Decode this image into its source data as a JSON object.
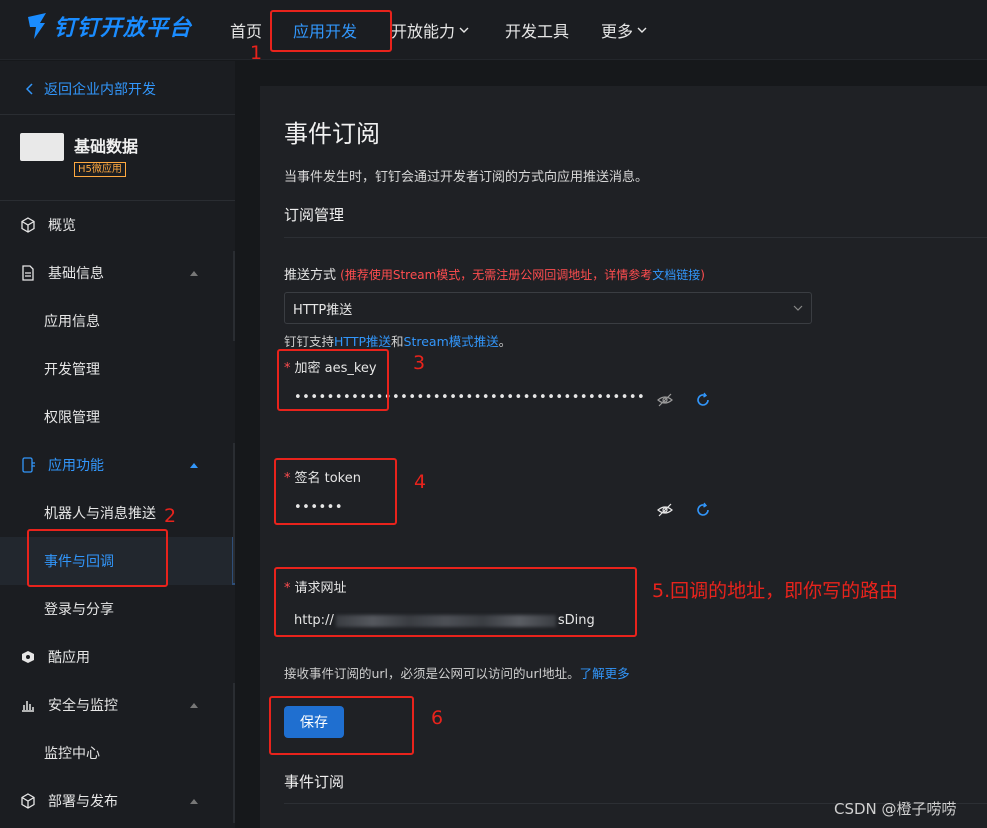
{
  "topnav": {
    "logo_text": "钉钉开放平台",
    "items": [
      {
        "label": "首页"
      },
      {
        "label": "应用开发",
        "active": true
      },
      {
        "label": "开放能力",
        "dropdown": true
      },
      {
        "label": "开发工具"
      },
      {
        "label": "更多",
        "dropdown": true
      }
    ]
  },
  "sidebar": {
    "back_label": "返回企业内部开发",
    "app": {
      "name": "基础数据",
      "badge": "H5微应用"
    },
    "items": [
      {
        "label": "概览",
        "icon": "cube-icon"
      },
      {
        "label": "基础信息",
        "icon": "document-icon",
        "expanded": true
      },
      {
        "label": "应用信息"
      },
      {
        "label": "开发管理"
      },
      {
        "label": "权限管理"
      },
      {
        "label": "应用功能",
        "icon": "phone-icon",
        "expanded": true
      },
      {
        "label": "机器人与消息推送"
      },
      {
        "label": "事件与回调",
        "selected": true
      },
      {
        "label": "登录与分享"
      },
      {
        "label": "酷应用",
        "icon": "cool-app-icon"
      },
      {
        "label": "安全与监控",
        "icon": "bar-chart-icon",
        "expanded": true
      },
      {
        "label": "监控中心"
      },
      {
        "label": "部署与发布",
        "icon": "cube-icon",
        "expanded": true
      }
    ]
  },
  "main": {
    "title": "事件订阅",
    "description": "当事件发生时，钉钉会通过开发者订阅的方式向应用推送消息。",
    "subscription_title": "订阅管理",
    "push_mode": {
      "label": "推送方式",
      "note": "(推荐使用Stream模式，无需注册公网回调地址，详情参考",
      "note_link": "文档链接",
      "note_end": ")",
      "selected": "HTTP推送",
      "help_prefix": "钉钉支持",
      "help_link1": "HTTP推送",
      "help_mid": "和",
      "help_link2": "Stream模式推送",
      "help_end": "。"
    },
    "aes_key": {
      "label": "加密 aes_key",
      "value": "•••••••••••••••••••••••••••••••••••••••••••"
    },
    "token": {
      "label": "签名 token",
      "value": "••••••"
    },
    "request_url": {
      "label": "请求网址",
      "prefix": "http://",
      "suffix": "sDing"
    },
    "url_help": "接收事件订阅的url，必须是公网可以访问的url地址。",
    "url_help_link": "了解更多",
    "save_label": "保存",
    "event_subscription_title": "事件订阅"
  },
  "annotations": [
    "1",
    "2",
    "3",
    "4",
    "5.回调的地址，即你写的路由",
    "6"
  ],
  "watermark": "CSDN @橙子唠唠",
  "colors": {
    "accent": "#3296fa",
    "annotation": "#e8231c",
    "required": "#ff4d4f",
    "background": "#16181b"
  }
}
